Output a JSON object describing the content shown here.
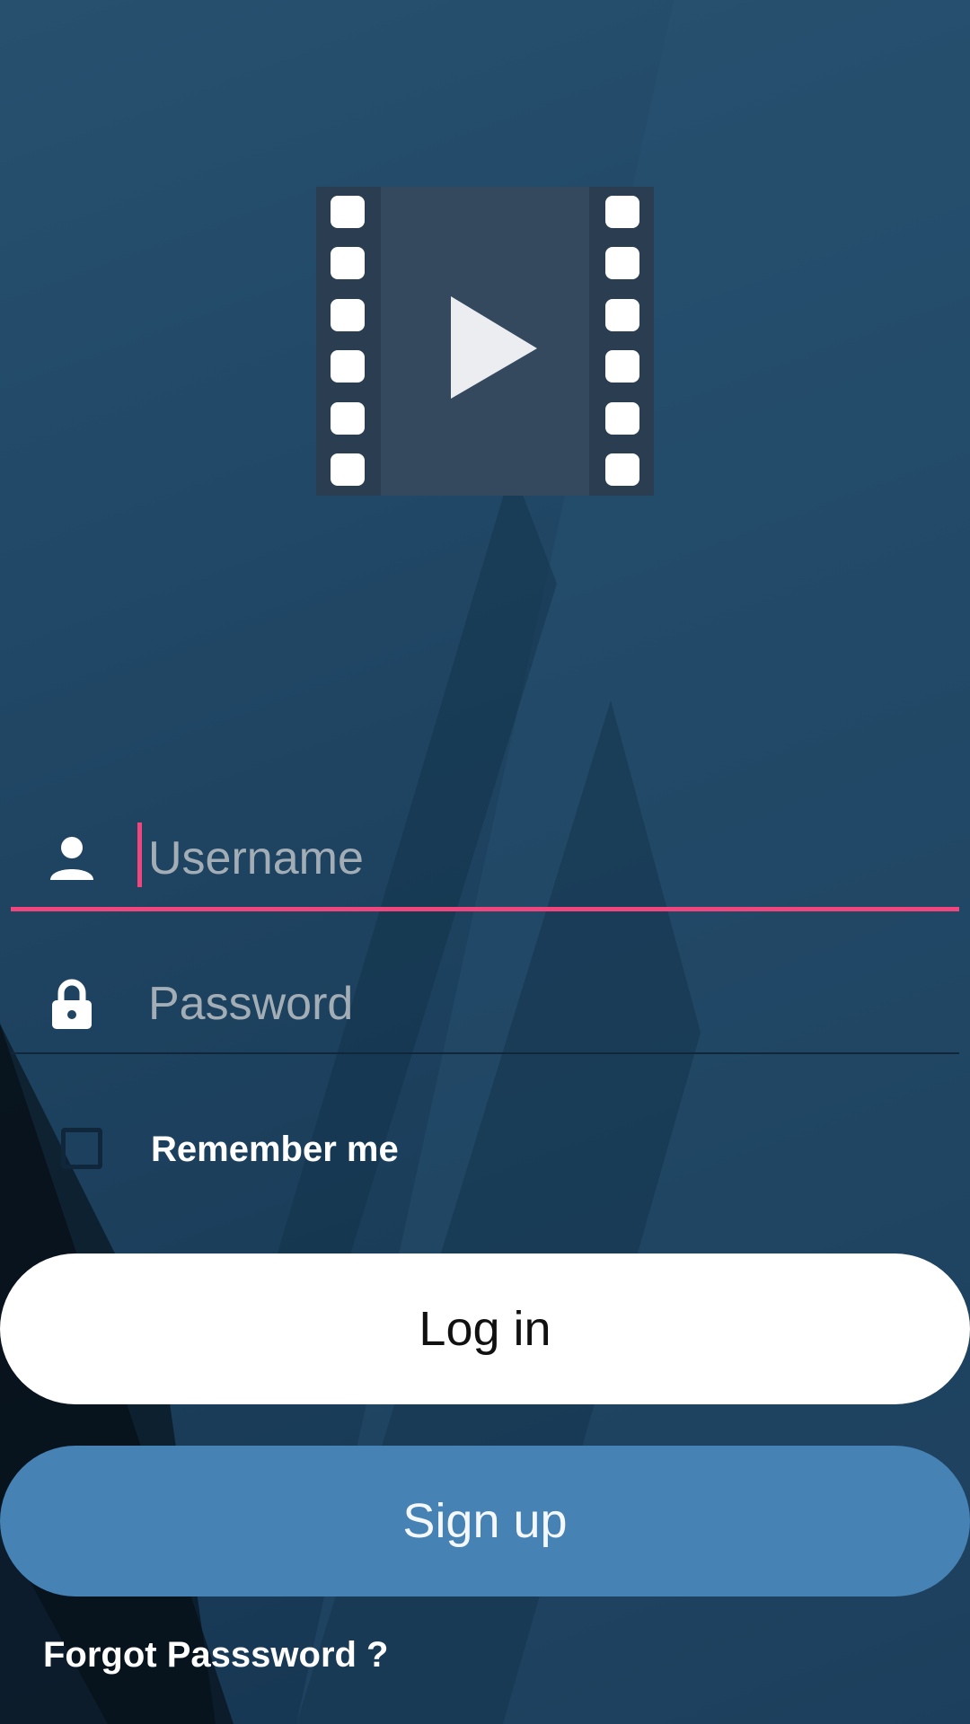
{
  "logo": {
    "icon": "video-film-play-icon"
  },
  "username": {
    "placeholder": "Username",
    "value": "",
    "icon": "person-icon"
  },
  "password": {
    "placeholder": "Password",
    "value": "",
    "icon": "lock-icon"
  },
  "remember": {
    "label": "Remember me",
    "checked": false
  },
  "buttons": {
    "login_label": "Log in",
    "signup_label": "Sign up"
  },
  "forgot": {
    "label": "Forgot Passsword ?"
  },
  "colors": {
    "accent": "#f0457d",
    "signup_button": "#4682b4",
    "login_button": "#ffffff",
    "background": "#1f4563"
  }
}
